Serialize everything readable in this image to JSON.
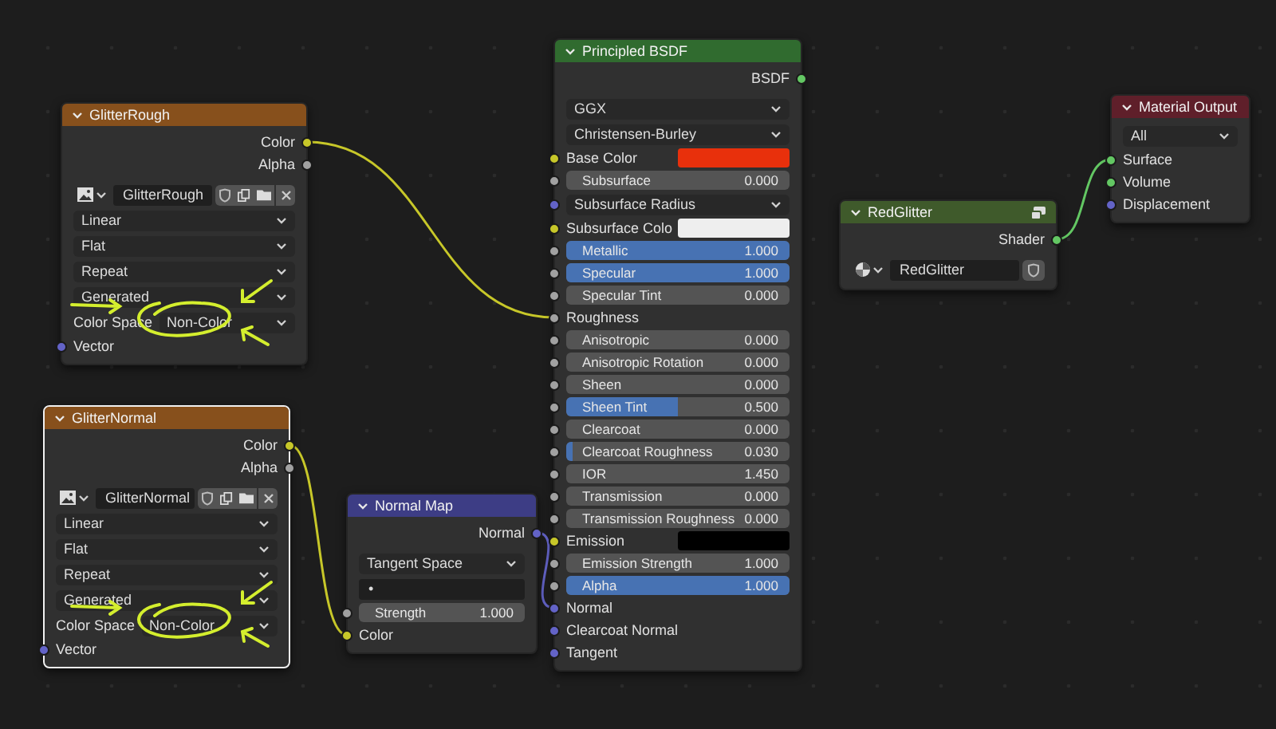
{
  "nodes": [
    {
      "title": "GlitterRough",
      "color": "#87501c",
      "selected": false,
      "rows": [
        {
          "kind": "output",
          "label": "Color",
          "socket": {
            "color": "#c7c729"
          }
        },
        {
          "kind": "output",
          "label": "Alpha",
          "socket": {
            "color": "#a1a1a1"
          }
        },
        {
          "kind": "image",
          "value": "GlitterRough"
        },
        {
          "kind": "dropdown",
          "value": "Linear"
        },
        {
          "kind": "dropdown",
          "value": "Flat"
        },
        {
          "kind": "dropdown",
          "value": "Repeat"
        },
        {
          "kind": "dropdown",
          "value": "Generated"
        },
        {
          "kind": "labeled-dropdown",
          "label": "Color Space",
          "value": "Non-Color"
        },
        {
          "kind": "input",
          "label": "Vector",
          "socket": {
            "color": "#6363c7"
          }
        }
      ]
    },
    {
      "title": "GlitterNormal",
      "color": "#87501c",
      "selected": true,
      "rows": [
        {
          "kind": "output",
          "label": "Color",
          "socket": {
            "color": "#c7c729"
          }
        },
        {
          "kind": "output",
          "label": "Alpha",
          "socket": {
            "color": "#a1a1a1"
          }
        },
        {
          "kind": "image",
          "value": "GlitterNormal"
        },
        {
          "kind": "dropdown",
          "value": "Linear"
        },
        {
          "kind": "dropdown",
          "value": "Flat"
        },
        {
          "kind": "dropdown",
          "value": "Repeat"
        },
        {
          "kind": "dropdown",
          "value": "Generated"
        },
        {
          "kind": "labeled-dropdown",
          "label": "Color Space",
          "value": "Non-Color"
        },
        {
          "kind": "input",
          "label": "Vector",
          "socket": {
            "color": "#6363c7"
          }
        }
      ]
    },
    {
      "title": "Normal Map",
      "color": "#3d3d85",
      "selected": false,
      "rows": [
        {
          "kind": "output",
          "label": "Normal",
          "socket": {
            "color": "#6363c7"
          }
        },
        {
          "kind": "dropdown",
          "value": "Tangent Space"
        },
        {
          "kind": "field",
          "value": "•"
        },
        {
          "kind": "number",
          "label": "Strength",
          "value": "1.000",
          "socket": {
            "color": "#a1a1a1"
          }
        },
        {
          "kind": "input",
          "label": "Color",
          "socket": {
            "color": "#c7c729"
          }
        }
      ]
    },
    {
      "title": "Principled BSDF",
      "color": "#306b2f",
      "selected": false,
      "rows": [
        {
          "kind": "output",
          "label": "BSDF",
          "socket": {
            "color": "#63c763"
          }
        },
        {
          "kind": "dropdown",
          "value": "GGX"
        },
        {
          "kind": "dropdown",
          "value": "Christensen-Burley"
        },
        {
          "kind": "color",
          "label": "Base Color",
          "color": "#e8300c",
          "socket": {
            "color": "#c7c729"
          }
        },
        {
          "kind": "slider",
          "label": "Subsurface",
          "value": "0.000",
          "level": 0,
          "socket": {
            "color": "#a1a1a1"
          }
        },
        {
          "kind": "dropdown",
          "value": "Subsurface Radius",
          "socket": {
            "color": "#6363c7"
          }
        },
        {
          "kind": "color",
          "label": "Subsurface Colo",
          "color": "#eeeeee",
          "socket": {
            "color": "#c7c729"
          }
        },
        {
          "kind": "slider",
          "label": "Metallic",
          "value": "1.000",
          "level": 1,
          "socket": {
            "color": "#a1a1a1"
          }
        },
        {
          "kind": "slider",
          "label": "Specular",
          "value": "1.000",
          "level": 1,
          "socket": {
            "color": "#a1a1a1"
          }
        },
        {
          "kind": "slider",
          "label": "Specular Tint",
          "value": "0.000",
          "level": 0,
          "socket": {
            "color": "#a1a1a1"
          }
        },
        {
          "kind": "input",
          "label": "Roughness",
          "socket": {
            "color": "#a1a1a1"
          }
        },
        {
          "kind": "slider",
          "label": "Anisotropic",
          "value": "0.000",
          "level": 0,
          "socket": {
            "color": "#a1a1a1"
          }
        },
        {
          "kind": "slider",
          "label": "Anisotropic Rotation",
          "value": "0.000",
          "level": 0,
          "socket": {
            "color": "#a1a1a1"
          }
        },
        {
          "kind": "slider",
          "label": "Sheen",
          "value": "0.000",
          "level": 0,
          "socket": {
            "color": "#a1a1a1"
          }
        },
        {
          "kind": "slider",
          "label": "Sheen Tint",
          "value": "0.500",
          "level": 0.5,
          "socket": {
            "color": "#a1a1a1"
          }
        },
        {
          "kind": "slider",
          "label": "Clearcoat",
          "value": "0.000",
          "level": 0,
          "socket": {
            "color": "#a1a1a1"
          }
        },
        {
          "kind": "slider",
          "label": "Clearcoat Roughness",
          "value": "0.030",
          "level": 0.03,
          "socket": {
            "color": "#a1a1a1"
          }
        },
        {
          "kind": "number",
          "label": "IOR",
          "value": "1.450",
          "socket": {
            "color": "#a1a1a1"
          }
        },
        {
          "kind": "slider",
          "label": "Transmission",
          "value": "0.000",
          "level": 0,
          "socket": {
            "color": "#a1a1a1"
          }
        },
        {
          "kind": "slider",
          "label": "Transmission Roughness",
          "value": "0.000",
          "level": 0,
          "socket": {
            "color": "#a1a1a1"
          }
        },
        {
          "kind": "color",
          "label": "Emission",
          "color": "#000000",
          "socket": {
            "color": "#c7c729"
          }
        },
        {
          "kind": "number",
          "label": "Emission Strength",
          "value": "1.000",
          "socket": {
            "color": "#a1a1a1"
          }
        },
        {
          "kind": "slider",
          "label": "Alpha",
          "value": "1.000",
          "level": 1,
          "socket": {
            "color": "#a1a1a1"
          }
        },
        {
          "kind": "input",
          "label": "Normal",
          "socket": {
            "color": "#6363c7"
          }
        },
        {
          "kind": "input",
          "label": "Clearcoat Normal",
          "socket": {
            "color": "#6363c7"
          }
        },
        {
          "kind": "input",
          "label": "Tangent",
          "socket": {
            "color": "#6363c7"
          }
        }
      ]
    },
    {
      "title": "RedGlitter",
      "color": "#3f5a2b",
      "selected": false,
      "preview_toggle": true,
      "rows": [
        {
          "kind": "output",
          "label": "Shader",
          "socket": {
            "color": "#63c763"
          }
        },
        {
          "kind": "material",
          "value": "RedGlitter"
        }
      ]
    },
    {
      "title": "Material Output",
      "color": "#5f1f2a",
      "selected": false,
      "rows": [
        {
          "kind": "dropdown",
          "value": "All"
        },
        {
          "kind": "input",
          "label": "Surface",
          "socket": {
            "color": "#63c763"
          }
        },
        {
          "kind": "input",
          "label": "Volume",
          "socket": {
            "color": "#63c763"
          }
        },
        {
          "kind": "input",
          "label": "Displacement",
          "socket": {
            "color": "#6363c7"
          }
        }
      ]
    }
  ]
}
